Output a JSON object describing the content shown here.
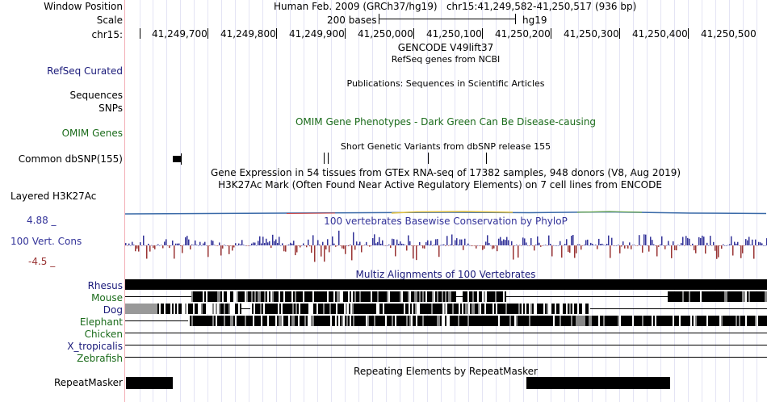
{
  "header": {
    "window_position_label": "Window Position",
    "window_position_text": "Human Feb. 2009 (GRCh37/hg19)   chr15:41,249,582-41,250,517 (936 bp)",
    "scale_label": "Scale",
    "scale_text": "200 bases",
    "scale_assembly": "hg19",
    "chrom_label": "chr15:",
    "positions": [
      "41,249,700",
      "41,249,800",
      "41,249,900",
      "41,250,000",
      "41,250,100",
      "41,250,200",
      "41,250,300",
      "41,250,400",
      "41,250,500"
    ]
  },
  "tracks": {
    "gencode_title": "GENCODE V49lift37",
    "refseq_title": "RefSeq genes from NCBI",
    "refseq_label": "RefSeq Curated",
    "publications_title": "Publications: Sequences in Scientific Articles",
    "sequences_label": "Sequences",
    "snps_label": "SNPs",
    "omim_title": "OMIM Gene Phenotypes - Dark Green Can Be Disease-causing",
    "omim_label": "OMIM Genes",
    "dbsnp_title": "Short Genetic Variants from dbSNP release 155",
    "dbsnp_label": "Common dbSNP(155)",
    "gtex_title": "Gene Expression in 54 tissues from GTEx RNA-seq of 17382 samples, 948 donors (V8, Aug 2019)",
    "h3k27ac_title": "H3K27Ac Mark (Often Found Near Active Regulatory Elements) on 7 cell lines from ENCODE",
    "h3k27ac_label": "Layered H3K27Ac",
    "cons_max": "4.88 _",
    "cons_title": "100 vertebrates Basewise Conservation by PhyloP",
    "cons_label": "100 Vert. Cons",
    "cons_min": "-4.5 _",
    "multiz_title": "Multiz Alignments of 100 Vertebrates",
    "species": [
      "Rhesus",
      "Mouse",
      "Dog",
      "Elephant",
      "Chicken",
      "X_tropicalis",
      "Zebrafish"
    ],
    "repeat_title": "Repeating Elements by RepeatMasker",
    "repeat_label": "RepeatMasker"
  },
  "colors": {
    "navy": "#1a1a7a",
    "green": "#1a6b1a",
    "cons_blue": "#333399",
    "cons_red": "#993333",
    "multiz_title": "#1a1a7a"
  }
}
